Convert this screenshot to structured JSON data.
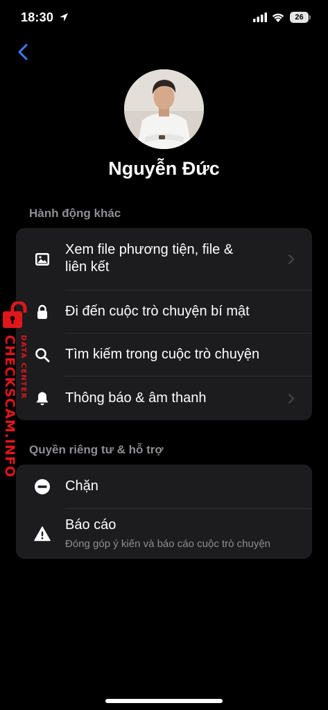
{
  "status_bar": {
    "time": "18:30",
    "battery": "26"
  },
  "profile": {
    "name": "Nguyễn Đức"
  },
  "sections": [
    {
      "title": "Hành động khác",
      "items": [
        {
          "label_line1": "Xem file phương tiện, file &",
          "label_line2": "liên kết",
          "icon": "image-icon",
          "chevron": true
        },
        {
          "label": "Đi đến cuộc trò chuyện bí mật",
          "icon": "lock-icon",
          "chevron": false
        },
        {
          "label": "Tìm kiếm trong cuộc trò chuyện",
          "icon": "search-icon",
          "chevron": false
        },
        {
          "label": "Thông báo & âm thanh",
          "icon": "bell-icon",
          "chevron": true
        }
      ]
    },
    {
      "title": "Quyền riêng tư & hỗ trợ",
      "items": [
        {
          "label": "Chặn",
          "icon": "block-icon"
        },
        {
          "label": "Báo cáo",
          "sublabel": "Đóng góp ý kiến và báo cáo cuộc trò chuyện",
          "icon": "warning-icon"
        }
      ]
    }
  ],
  "watermark": {
    "brand": "CHECKSCAM.INFO",
    "tagline": "DATA CENTER"
  },
  "colors": {
    "background": "#000000",
    "card": "#1c1c1e",
    "accent": "#3d7cf5",
    "secondary_text": "#8e8e93",
    "watermark": "#e0161b"
  }
}
